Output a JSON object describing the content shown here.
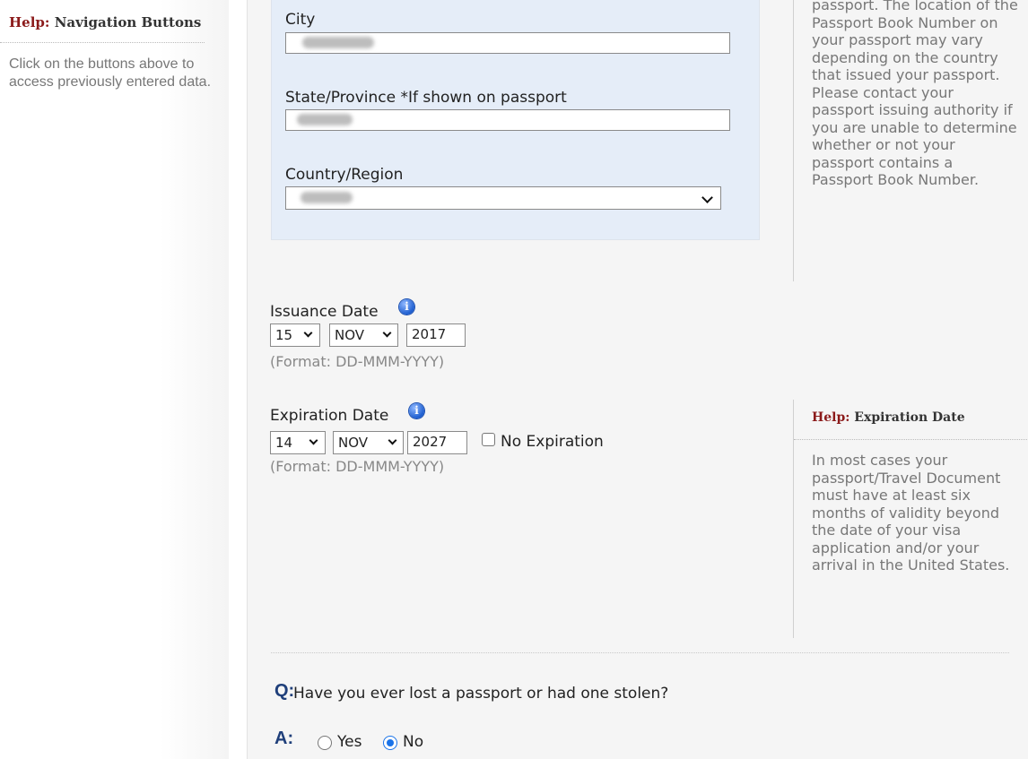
{
  "left_help": {
    "title_prefix": "Help:",
    "title": "Navigation Buttons",
    "body": "Click on the buttons above to access previously entered data."
  },
  "address": {
    "city_label": "City",
    "state_label": "State/Province *If shown on passport",
    "country_label": "Country/Region"
  },
  "right_help_1": {
    "body": "passport. The location of the Passport Book Number on your passport may vary depending on the country that issued your passport. Please contact your passport issuing authority if you are unable to determine whether or not your passport contains a Passport Book Number."
  },
  "issuance": {
    "label": "Issuance Date",
    "day": "15",
    "month": "NOV",
    "year": "2017",
    "format": "(Format: DD-MMM-YYYY)"
  },
  "expiration": {
    "label": "Expiration Date",
    "day": "14",
    "month": "NOV",
    "year": "2027",
    "no_expiration_label": "No Expiration",
    "no_expiration_checked": false,
    "format": "(Format: DD-MMM-YYYY)"
  },
  "right_help_2": {
    "title_prefix": "Help:",
    "title": "Expiration Date",
    "body": "In most cases your passport/Travel Document must have at least six months of validity beyond the date of your visa application and/or your arrival in the United States."
  },
  "question": {
    "q_letter": "Q:",
    "text": "Have you ever lost a passport or had one stolen?",
    "a_letter": "A:",
    "options": [
      {
        "label": "Yes",
        "selected": false
      },
      {
        "label": "No",
        "selected": true
      }
    ]
  },
  "icons": {
    "info": "info-icon",
    "dropdown": "chevron-down-icon"
  },
  "colors": {
    "help_prefix": "#8b1a1a",
    "qa_letter": "#1f3f7a",
    "radio_selected": "#1a73e8",
    "address_box_bg": "#e5edf8"
  }
}
